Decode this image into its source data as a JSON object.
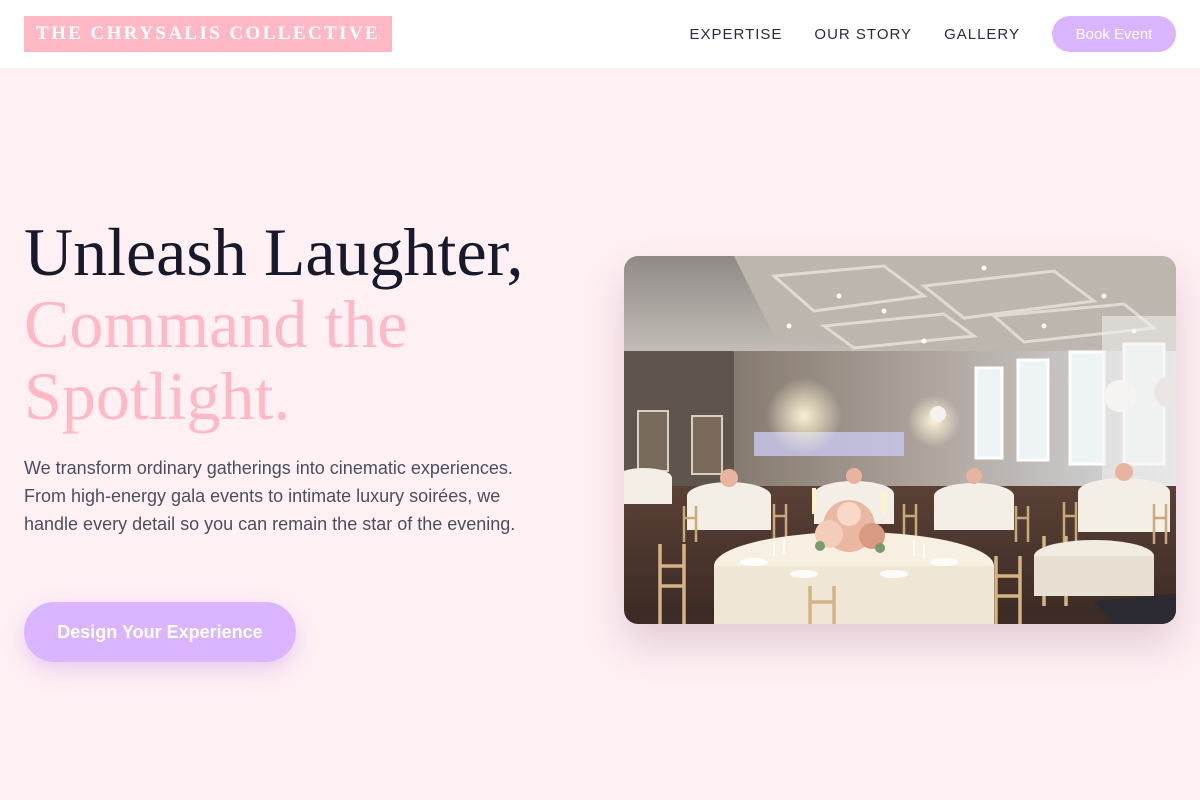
{
  "brand": {
    "name": "THE CHRYSALIS COLLECTIVE"
  },
  "nav": {
    "links": [
      {
        "label": "EXPERTISE"
      },
      {
        "label": "OUR STORY"
      },
      {
        "label": "GALLERY"
      }
    ],
    "cta_label": "Book Event"
  },
  "hero": {
    "title_line_1": "Unleash Laughter,",
    "title_line_2": "Command the",
    "title_line_3": "Spotlight.",
    "description": "We transform ordinary gatherings into cinematic experiences. From high-energy gala events to intimate luxury soirées, we handle every detail so you can remain the star of the evening.",
    "cta_label": "Design Your Experience",
    "image_subject": "banquet-hall-photo"
  },
  "colors": {
    "background": "#fff0f4",
    "brand_pink": "#ffb8c6",
    "accent_lavender": "#dbb4ff",
    "heading_dark": "#161a2b"
  }
}
